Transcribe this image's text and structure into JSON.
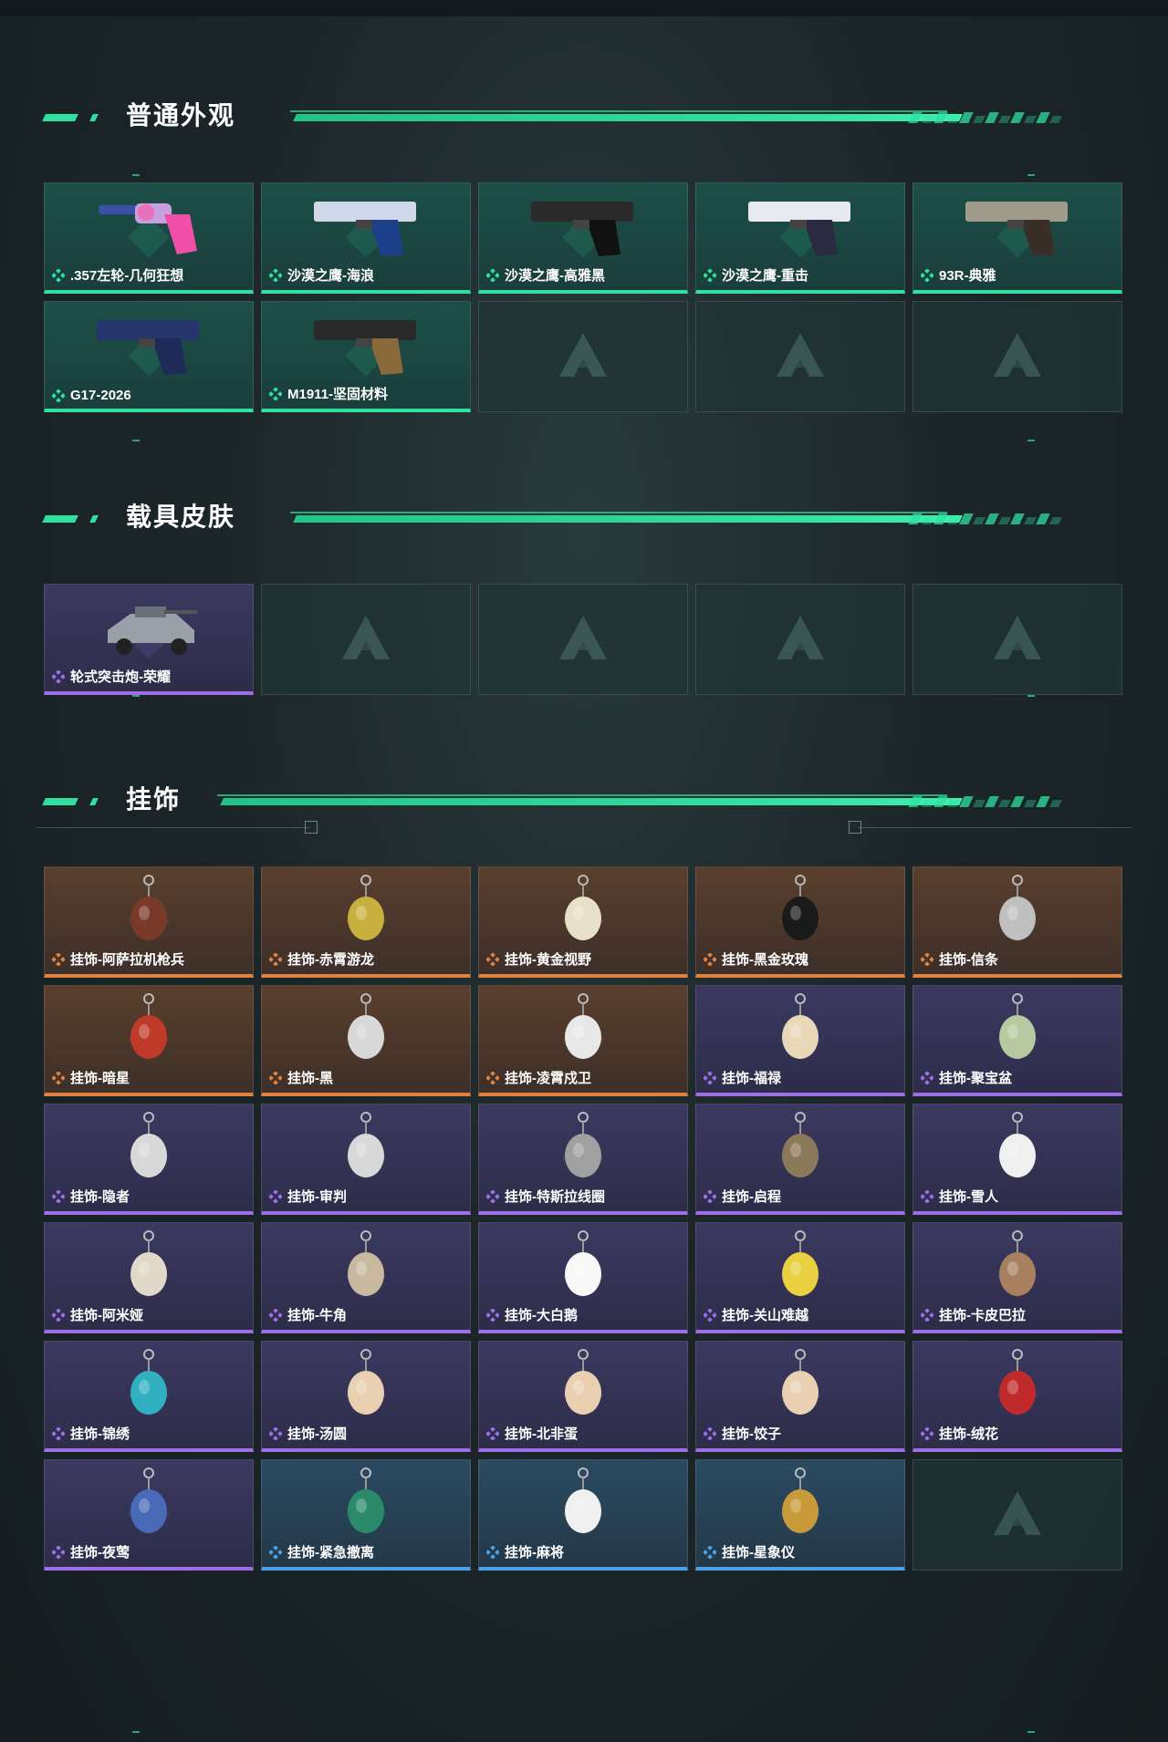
{
  "sections": [
    {
      "title": "普通外观",
      "items": [
        {
          "label": ".357左轮-几何狂想",
          "rarity": "green",
          "kind": "revolver"
        },
        {
          "label": "沙漠之鹰-海浪",
          "rarity": "green",
          "kind": "pistol-blue"
        },
        {
          "label": "沙漠之鹰-高雅黑",
          "rarity": "green",
          "kind": "pistol-black"
        },
        {
          "label": "沙漠之鹰-重击",
          "rarity": "green",
          "kind": "pistol-white"
        },
        {
          "label": "93R-典雅",
          "rarity": "green",
          "kind": "pistol-tan"
        },
        {
          "label": "G17-2026",
          "rarity": "green",
          "kind": "pistol-navy"
        },
        {
          "label": "M1911-坚固材料",
          "rarity": "green",
          "kind": "pistol-wood"
        },
        {
          "label": "",
          "rarity": "empty"
        },
        {
          "label": "",
          "rarity": "empty"
        },
        {
          "label": "",
          "rarity": "empty"
        }
      ]
    },
    {
      "title": "载具皮肤",
      "items": [
        {
          "label": "轮式突击炮-荣耀",
          "rarity": "purple",
          "kind": "vehicle"
        },
        {
          "label": "",
          "rarity": "empty"
        },
        {
          "label": "",
          "rarity": "empty"
        },
        {
          "label": "",
          "rarity": "empty"
        },
        {
          "label": "",
          "rarity": "empty"
        }
      ]
    },
    {
      "title": "挂饰",
      "items": [
        {
          "label": "挂饰-阿萨拉机枪兵",
          "rarity": "orange",
          "kind": "charm-a"
        },
        {
          "label": "挂饰-赤霄游龙",
          "rarity": "orange",
          "kind": "charm-b"
        },
        {
          "label": "挂饰-黄金视野",
          "rarity": "orange",
          "kind": "charm-c"
        },
        {
          "label": "挂饰-黑金玫瑰",
          "rarity": "orange",
          "kind": "charm-d"
        },
        {
          "label": "挂饰-信条",
          "rarity": "orange",
          "kind": "charm-e"
        },
        {
          "label": "挂饰-暗星",
          "rarity": "orange",
          "kind": "charm-f"
        },
        {
          "label": "挂饰-黑",
          "rarity": "orange",
          "kind": "charm-g"
        },
        {
          "label": "挂饰-凌霄戍卫",
          "rarity": "orange",
          "kind": "charm-h"
        },
        {
          "label": "挂饰-福禄",
          "rarity": "purple",
          "kind": "charm-i"
        },
        {
          "label": "挂饰-聚宝盆",
          "rarity": "purple",
          "kind": "charm-j"
        },
        {
          "label": "挂饰-隐者",
          "rarity": "purple",
          "kind": "charm-g"
        },
        {
          "label": "挂饰-审判",
          "rarity": "purple",
          "kind": "charm-g"
        },
        {
          "label": "挂饰-特斯拉线圈",
          "rarity": "purple",
          "kind": "charm-k"
        },
        {
          "label": "挂饰-启程",
          "rarity": "purple",
          "kind": "charm-l"
        },
        {
          "label": "挂饰-雪人",
          "rarity": "purple",
          "kind": "charm-m"
        },
        {
          "label": "挂饰-阿米娅",
          "rarity": "purple",
          "kind": "charm-n"
        },
        {
          "label": "挂饰-牛角",
          "rarity": "purple",
          "kind": "charm-o"
        },
        {
          "label": "挂饰-大白鹅",
          "rarity": "purple",
          "kind": "charm-p"
        },
        {
          "label": "挂饰-关山难越",
          "rarity": "purple",
          "kind": "charm-q"
        },
        {
          "label": "挂饰-卡皮巴拉",
          "rarity": "purple",
          "kind": "charm-r"
        },
        {
          "label": "挂饰-锦绣",
          "rarity": "purple",
          "kind": "charm-s"
        },
        {
          "label": "挂饰-汤圆",
          "rarity": "purple",
          "kind": "charm-t"
        },
        {
          "label": "挂饰-北非蛋",
          "rarity": "purple",
          "kind": "charm-t"
        },
        {
          "label": "挂饰-饺子",
          "rarity": "purple",
          "kind": "charm-t"
        },
        {
          "label": "挂饰-绒花",
          "rarity": "purple",
          "kind": "charm-u"
        },
        {
          "label": "挂饰-夜莺",
          "rarity": "purple",
          "kind": "charm-v"
        },
        {
          "label": "挂饰-紧急撤离",
          "rarity": "blue",
          "kind": "charm-w"
        },
        {
          "label": "挂饰-麻将",
          "rarity": "blue",
          "kind": "charm-x"
        },
        {
          "label": "挂饰-星象仪",
          "rarity": "blue",
          "kind": "charm-y"
        },
        {
          "label": "",
          "rarity": "empty"
        }
      ]
    }
  ],
  "colors": {
    "accent": "#2fe0a0",
    "green": "#2fe0a0",
    "purple": "#9d6ee8",
    "orange": "#e0823e",
    "blue": "#4aa3e8"
  },
  "icons": {
    "rarity": "diamond-cluster-icon",
    "placeholder": "triangle-logo-icon"
  }
}
